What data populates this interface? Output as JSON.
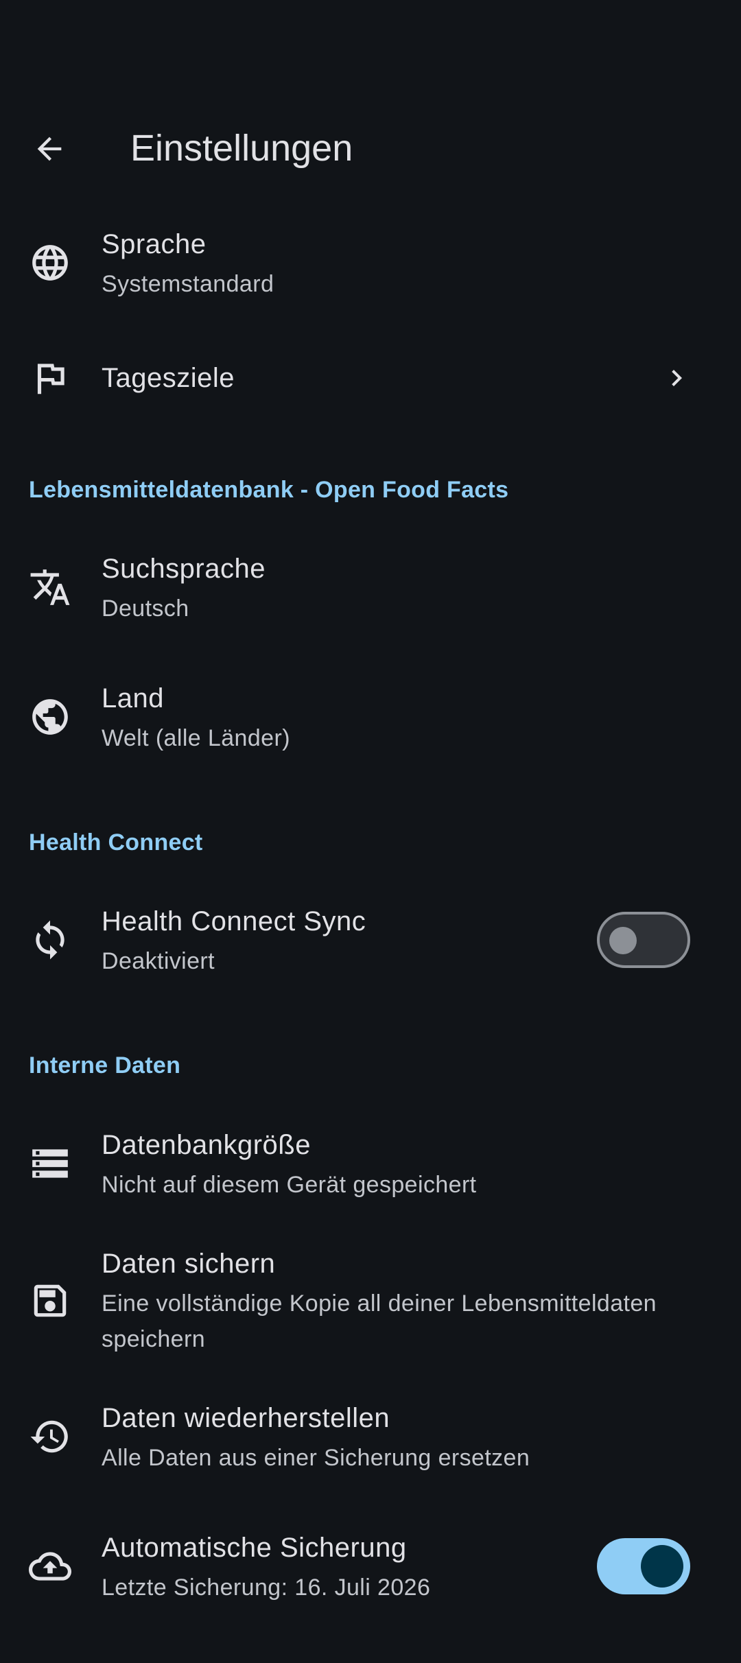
{
  "header": {
    "title": "Einstellungen",
    "back_icon": "arrow-back-icon"
  },
  "general": {
    "language": {
      "title": "Sprache",
      "subtitle": "Systemstandard",
      "icon": "globe-icon"
    },
    "daily_goals": {
      "title": "Tagesziele",
      "icon": "flag-icon"
    }
  },
  "food_database": {
    "header": "Lebensmitteldatenbank - Open Food Facts",
    "search_language": {
      "title": "Suchsprache",
      "subtitle": "Deutsch",
      "icon": "translate-icon"
    },
    "country": {
      "title": "Land",
      "subtitle": "Welt (alle Länder)",
      "icon": "public-earth-icon"
    }
  },
  "health_connect": {
    "header": "Health Connect",
    "sync": {
      "title": "Health Connect Sync",
      "subtitle": "Deaktiviert",
      "icon": "sync-icon",
      "enabled": false
    }
  },
  "internal_data": {
    "header": "Interne Daten",
    "db_size": {
      "title": "Datenbankgröße",
      "subtitle": "Nicht auf diesem Gerät gespeichert",
      "icon": "storage-icon"
    },
    "backup": {
      "title": "Daten sichern",
      "subtitle": "Eine vollständige Kopie all deiner Lebensmitteldaten speichern",
      "icon": "save-icon"
    },
    "restore": {
      "title": "Daten wiederherstellen",
      "subtitle": "Alle Daten aus einer Sicherung ersetzen",
      "icon": "history-icon"
    },
    "auto_backup": {
      "title": "Automatische Sicherung",
      "subtitle": "Letzte Sicherung: 16. Juli 2026",
      "icon": "cloud-upload-icon",
      "enabled": true
    }
  },
  "colors": {
    "background": "#111418",
    "accent": "#8fcdf5",
    "text_primary": "#e2e2e6",
    "text_secondary": "#c3c6cc"
  }
}
